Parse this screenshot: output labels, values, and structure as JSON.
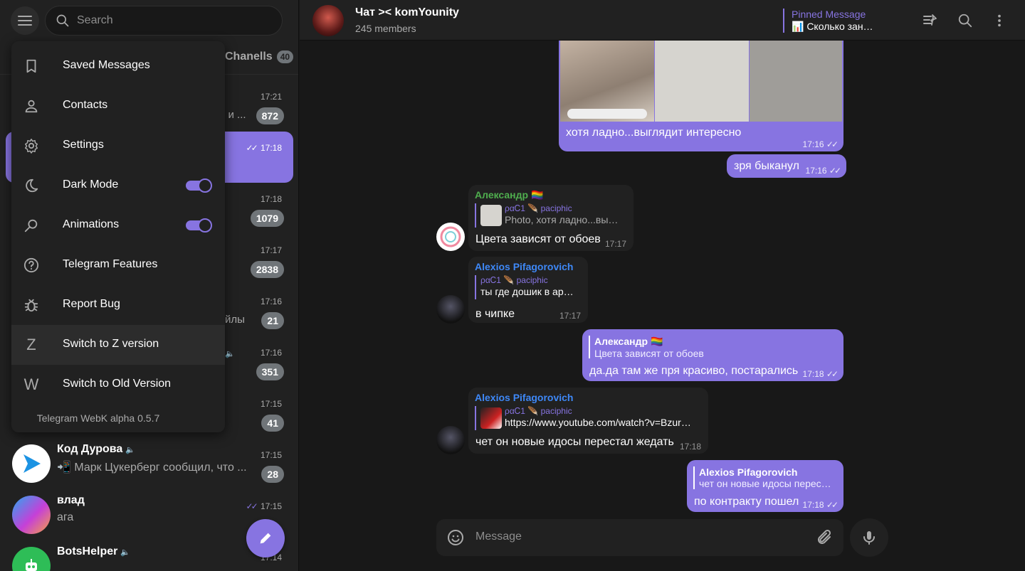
{
  "search": {
    "placeholder": "Search"
  },
  "tabs": {
    "channels_label": "Chanells",
    "channels_count": "40"
  },
  "chats": [
    {
      "time": "17:21",
      "preview_fragment": "о и ...",
      "badge": "872"
    },
    {
      "time": "17:18",
      "active": true
    },
    {
      "time": "17:18",
      "badge": "1079"
    },
    {
      "time": "17:17",
      "badge": "2838"
    },
    {
      "time": "17:16",
      "preview_fragment": "йлы",
      "badge": "21"
    },
    {
      "time": "17:16",
      "badge": "351"
    },
    {
      "time": "17:15",
      "badge": "41"
    },
    {
      "title": "Код Дурова",
      "time": "17:15",
      "preview": "📲 Марк Цукерберг сообщил, что ...",
      "badge": "28"
    },
    {
      "title": "влад",
      "time": "17:15",
      "preview": "ага"
    },
    {
      "title": "BotsHelper",
      "time": "17:14"
    }
  ],
  "menu": {
    "items": [
      {
        "label": "Saved Messages",
        "icon": "bookmark-icon"
      },
      {
        "label": "Contacts",
        "icon": "person-icon"
      },
      {
        "label": "Settings",
        "icon": "gear-icon"
      },
      {
        "label": "Dark Mode",
        "icon": "moon-icon",
        "toggle": true
      },
      {
        "label": "Animations",
        "icon": "animation-icon",
        "toggle": true
      },
      {
        "label": "Telegram Features",
        "icon": "help-icon"
      },
      {
        "label": "Report Bug",
        "icon": "bug-icon"
      },
      {
        "label": "Switch to Z version",
        "icon": "z-letter-icon",
        "glyph": "Z"
      },
      {
        "label": "Switch to Old Version",
        "icon": "w-letter-icon",
        "glyph": "W"
      }
    ],
    "version": "Telegram WebK alpha 0.5.7"
  },
  "header": {
    "title": "Чат >< komYounity",
    "subtitle": "245 members",
    "pinned_title": "Pinned Message",
    "pinned_text": "📊 Сколько зан…"
  },
  "messages": {
    "m1": {
      "text": "хотя ладно...выглядит интересно",
      "time": "17:16"
    },
    "m2": {
      "text": "зря быканул",
      "time": "17:16"
    },
    "m3": {
      "sender": "Александр 🏳️‍🌈",
      "reply_name": "ραᏟ1 🪶 paciphic",
      "reply_text": "Photo, хотя ладно...вы…",
      "text": "Цвета зависят от обоев",
      "time": "17:17"
    },
    "m4": {
      "sender": "Alexios Pifagorovich",
      "reply_name": "ραᏟ1 🪶 paciphic",
      "reply_text": "ты где дошик в ар…",
      "text": "в чипке",
      "time": "17:17"
    },
    "m5": {
      "reply_name": "Александр 🏳️‍🌈",
      "reply_text": "Цвета зависят от обоев",
      "text": "да.да там же пря красиво, постарались",
      "time": "17:18"
    },
    "m6": {
      "sender": "Alexios Pifagorovich",
      "reply_name": "ραᏟ1 🪶 paciphic",
      "reply_text": "https://www.youtube.com/watch?v=Bzur…",
      "text": "чет он новые идосы перестал жедать",
      "time": "17:18"
    },
    "m7": {
      "reply_name": "Alexios Pifagorovich",
      "reply_text": "чет он новые идосы перес…",
      "text": "по контракту пошел",
      "time": "17:18"
    }
  },
  "composer": {
    "placeholder": "Message"
  },
  "colors": {
    "accent": "#8774e1",
    "bg": "#181818",
    "panel": "#212121",
    "alexandr": "#4fae4e",
    "alexios": "#3e88f7"
  }
}
